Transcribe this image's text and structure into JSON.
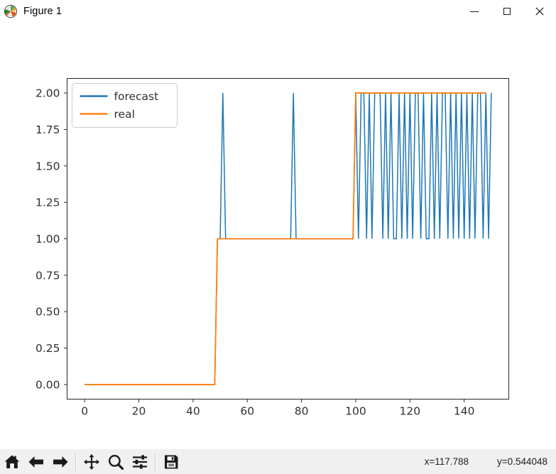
{
  "window": {
    "title": "Figure 1",
    "icon": "matplotlib-logo-icon",
    "buttons": {
      "minimize": "minimize-icon",
      "maximize": "maximize-icon",
      "close": "close-icon"
    }
  },
  "toolbar": {
    "items": [
      {
        "name": "home-button",
        "icon": "home-icon",
        "tooltip": "Reset original view"
      },
      {
        "name": "back-button",
        "icon": "arrow-left-icon",
        "tooltip": "Back to previous view"
      },
      {
        "name": "forward-button",
        "icon": "arrow-right-icon",
        "tooltip": "Forward to next view"
      },
      {
        "name": "pan-button",
        "icon": "move-icon",
        "tooltip": "Pan axes with left mouse, zoom with right"
      },
      {
        "name": "zoom-button",
        "icon": "magnifier-icon",
        "tooltip": "Zoom to rectangle"
      },
      {
        "name": "configure-subplots-button",
        "icon": "sliders-icon",
        "tooltip": "Configure subplots"
      },
      {
        "name": "save-button",
        "icon": "floppy-disk-icon",
        "tooltip": "Save the figure"
      }
    ],
    "coord_x": "x=117.788",
    "coord_y": "y=0.544048"
  },
  "chart_data": {
    "type": "line",
    "title": "",
    "xlabel": "",
    "ylabel": "",
    "xlim": [
      -6.45,
      156.45
    ],
    "ylim": [
      -0.1,
      2.1
    ],
    "xticks": [
      0,
      20,
      40,
      60,
      80,
      100,
      120,
      140
    ],
    "xticklabels": [
      "0",
      "20",
      "40",
      "60",
      "80",
      "100",
      "120",
      "140"
    ],
    "yticks": [
      0.0,
      0.25,
      0.5,
      0.75,
      1.0,
      1.25,
      1.5,
      1.75,
      2.0
    ],
    "yticklabels": [
      "0.00",
      "0.25",
      "0.50",
      "0.75",
      "1.00",
      "1.25",
      "1.50",
      "1.75",
      "2.00"
    ],
    "grid": false,
    "legend": {
      "position": "upper left",
      "entries": [
        {
          "label": "forecast",
          "color": "#1f77b4"
        },
        {
          "label": "real",
          "color": "#ff7f0e"
        }
      ]
    },
    "series": [
      {
        "name": "forecast",
        "color": "#1f77b4",
        "linewidth": 1.5,
        "x": [
          0,
          1,
          2,
          3,
          4,
          5,
          6,
          7,
          8,
          9,
          10,
          11,
          12,
          13,
          14,
          15,
          16,
          17,
          18,
          19,
          20,
          21,
          22,
          23,
          24,
          25,
          26,
          27,
          28,
          29,
          30,
          31,
          32,
          33,
          34,
          35,
          36,
          37,
          38,
          39,
          40,
          41,
          42,
          43,
          44,
          45,
          46,
          47,
          48,
          49,
          50,
          51,
          52,
          53,
          54,
          55,
          56,
          57,
          58,
          59,
          60,
          61,
          62,
          63,
          64,
          65,
          66,
          67,
          68,
          69,
          70,
          71,
          72,
          73,
          74,
          75,
          76,
          77,
          78,
          79,
          80,
          81,
          82,
          83,
          84,
          85,
          86,
          87,
          88,
          89,
          90,
          91,
          92,
          93,
          94,
          95,
          96,
          97,
          98,
          99,
          100,
          101,
          102,
          103,
          104,
          105,
          106,
          107,
          108,
          109,
          110,
          111,
          112,
          113,
          114,
          115,
          116,
          117,
          118,
          119,
          120,
          121,
          122,
          123,
          124,
          125,
          126,
          127,
          128,
          129,
          130,
          131,
          132,
          133,
          134,
          135,
          136,
          137,
          138,
          139,
          140,
          141,
          142,
          143,
          144,
          145,
          146,
          147,
          148,
          149,
          150
        ],
        "y": [
          0,
          0,
          0,
          0,
          0,
          0,
          0,
          0,
          0,
          0,
          0,
          0,
          0,
          0,
          0,
          0,
          0,
          0,
          0,
          0,
          0,
          0,
          0,
          0,
          0,
          0,
          0,
          0,
          0,
          0,
          0,
          0,
          0,
          0,
          0,
          0,
          0,
          0,
          0,
          0,
          0,
          0,
          0,
          0,
          0,
          0,
          0,
          0,
          0,
          1,
          1,
          2,
          1,
          1,
          1,
          1,
          1,
          1,
          1,
          1,
          1,
          1,
          1,
          1,
          1,
          1,
          1,
          1,
          1,
          1,
          1,
          1,
          1,
          1,
          1,
          1,
          1,
          2,
          1,
          1,
          1,
          1,
          1,
          1,
          1,
          1,
          1,
          1,
          1,
          1,
          1,
          1,
          1,
          1,
          1,
          1,
          1,
          1,
          1,
          1,
          2,
          1,
          2,
          2,
          1,
          2,
          1,
          2,
          2,
          2,
          1,
          2,
          1,
          2,
          1,
          1,
          2,
          1,
          2,
          1,
          2,
          1,
          2,
          2,
          1,
          2,
          1,
          1,
          2,
          1,
          2,
          1,
          2,
          2,
          1,
          2,
          1,
          2,
          1,
          2,
          1,
          2,
          1,
          2,
          1,
          2,
          2,
          1,
          2,
          1,
          2
        ]
      },
      {
        "name": "real",
        "color": "#ff7f0e",
        "linewidth": 1.8,
        "x": [
          0,
          1,
          2,
          3,
          4,
          5,
          6,
          7,
          8,
          9,
          10,
          11,
          12,
          13,
          14,
          15,
          16,
          17,
          18,
          19,
          20,
          21,
          22,
          23,
          24,
          25,
          26,
          27,
          28,
          29,
          30,
          31,
          32,
          33,
          34,
          35,
          36,
          37,
          38,
          39,
          40,
          41,
          42,
          43,
          44,
          45,
          46,
          47,
          48,
          49,
          50,
          51,
          52,
          53,
          54,
          55,
          56,
          57,
          58,
          59,
          60,
          61,
          62,
          63,
          64,
          65,
          66,
          67,
          68,
          69,
          70,
          71,
          72,
          73,
          74,
          75,
          76,
          77,
          78,
          79,
          80,
          81,
          82,
          83,
          84,
          85,
          86,
          87,
          88,
          89,
          90,
          91,
          92,
          93,
          94,
          95,
          96,
          97,
          98,
          99,
          100,
          101,
          102,
          103,
          104,
          105,
          106,
          107,
          108,
          109,
          110,
          111,
          112,
          113,
          114,
          115,
          116,
          117,
          118,
          119,
          120,
          121,
          122,
          123,
          124,
          125,
          126,
          127,
          128,
          129,
          130,
          131,
          132,
          133,
          134,
          135,
          136,
          137,
          138,
          139,
          140,
          141,
          142,
          143,
          144,
          145,
          146,
          147,
          148
        ],
        "y": [
          0,
          0,
          0,
          0,
          0,
          0,
          0,
          0,
          0,
          0,
          0,
          0,
          0,
          0,
          0,
          0,
          0,
          0,
          0,
          0,
          0,
          0,
          0,
          0,
          0,
          0,
          0,
          0,
          0,
          0,
          0,
          0,
          0,
          0,
          0,
          0,
          0,
          0,
          0,
          0,
          0,
          0,
          0,
          0,
          0,
          0,
          0,
          0,
          0,
          1,
          1,
          1,
          1,
          1,
          1,
          1,
          1,
          1,
          1,
          1,
          1,
          1,
          1,
          1,
          1,
          1,
          1,
          1,
          1,
          1,
          1,
          1,
          1,
          1,
          1,
          1,
          1,
          1,
          1,
          1,
          1,
          1,
          1,
          1,
          1,
          1,
          1,
          1,
          1,
          1,
          1,
          1,
          1,
          1,
          1,
          1,
          1,
          1,
          1,
          1,
          2,
          2,
          2,
          2,
          2,
          2,
          2,
          2,
          2,
          2,
          2,
          2,
          2,
          2,
          2,
          2,
          2,
          2,
          2,
          2,
          2,
          2,
          2,
          2,
          2,
          2,
          2,
          2,
          2,
          2,
          2,
          2,
          2,
          2,
          2,
          2,
          2,
          2,
          2,
          2,
          2,
          2,
          2,
          2,
          2,
          2,
          2,
          2,
          2
        ]
      }
    ]
  }
}
